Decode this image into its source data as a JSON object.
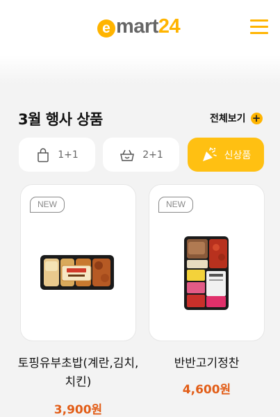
{
  "header": {
    "logo_e": "e",
    "logo_mart": "mart",
    "logo_num": "24"
  },
  "section": {
    "title": "3월 행사 상품",
    "view_all_label": "전체보기",
    "view_all_icon": "plus-circle-icon"
  },
  "tabs": [
    {
      "label": "1+1",
      "icon": "shopping-bag-icon",
      "active": false
    },
    {
      "label": "2+1",
      "icon": "basket-icon",
      "active": false
    },
    {
      "label": "신상품",
      "icon": "party-popper-icon",
      "active": true
    }
  ],
  "products": [
    {
      "badge": "NEW",
      "name": "토핑유부초밥(계란,김치,치킨)",
      "price": "3,900원"
    },
    {
      "badge": "NEW",
      "name": "반반고기정찬",
      "price": "4,600원"
    }
  ],
  "colors": {
    "accent": "#ffc012",
    "brand_yellow": "#ffb400",
    "price": "#e25d17",
    "background": "#f3f3f3"
  }
}
